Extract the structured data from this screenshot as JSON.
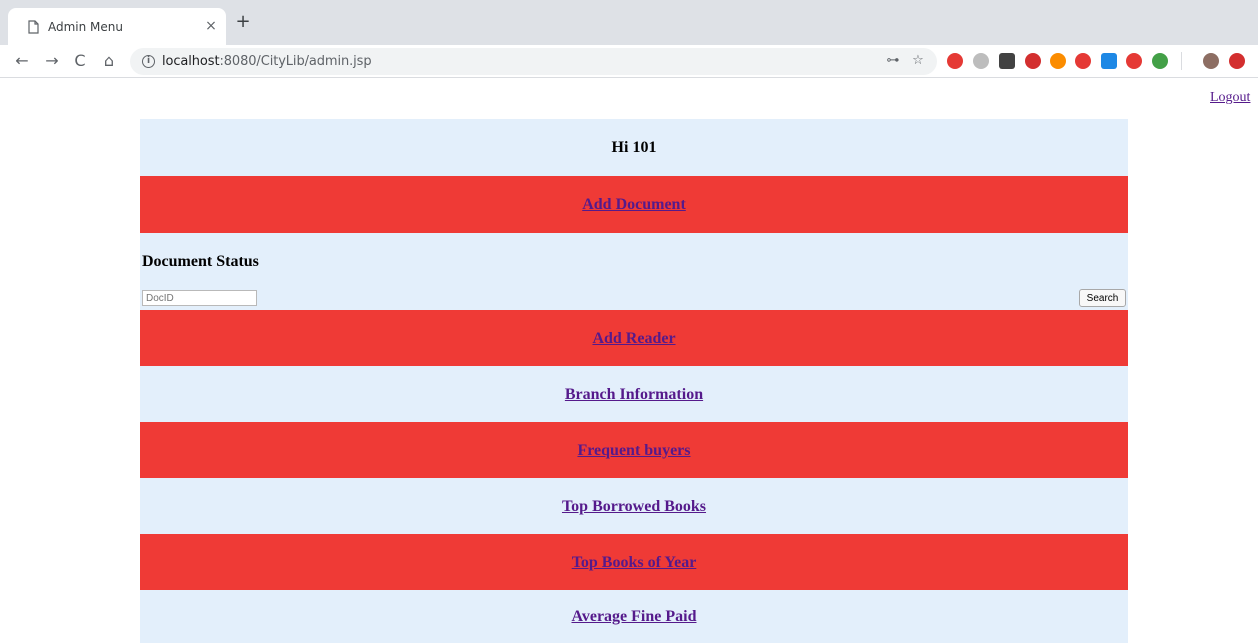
{
  "browser": {
    "tab_title": "Admin Menu",
    "tab_close": "×",
    "new_tab": "+",
    "nav": {
      "back": "←",
      "forward": "→",
      "reload": "C",
      "home": "⌂"
    },
    "url_host": "localhost",
    "url_rest": ":8080/CityLib/admin.jsp",
    "info_glyph": "i",
    "key_glyph": "⊶",
    "star_glyph": "☆",
    "extensions": [
      {
        "name": "adblock-icon",
        "color": "#e53935"
      },
      {
        "name": "circle-extension-icon",
        "color": "#bdbdbd"
      },
      {
        "name": "qr-extension-icon",
        "color": "#424242"
      },
      {
        "name": "stop-extension-icon",
        "color": "#d32f2f"
      },
      {
        "name": "off-extension-icon",
        "color": "#fb8c00"
      },
      {
        "name": "robot-extension-icon",
        "color": "#e53935"
      },
      {
        "name": "windows-extension-icon",
        "color": "#1e88e5"
      },
      {
        "name": "tomato-extension-icon",
        "color": "#e53935"
      },
      {
        "name": "green-extension-icon",
        "color": "#43a047"
      },
      {
        "name": "profile-avatar-icon",
        "color": "#8d6e63"
      },
      {
        "name": "red-o-extension-icon",
        "color": "#d32f2f"
      }
    ]
  },
  "page": {
    "logout": "Logout",
    "greeting": "Hi 101",
    "add_document": "Add Document",
    "document_status": {
      "heading": "Document Status",
      "input_placeholder": "DocID",
      "search_label": "Search"
    },
    "links": [
      "Add Reader",
      "Branch Information",
      "Frequent buyers",
      "Top Borrowed Books",
      "Top Books of Year",
      "Average Fine Paid"
    ]
  },
  "colors": {
    "light_row": "#e3effb",
    "red_row": "#ef3a36",
    "link": "#551a8b"
  }
}
